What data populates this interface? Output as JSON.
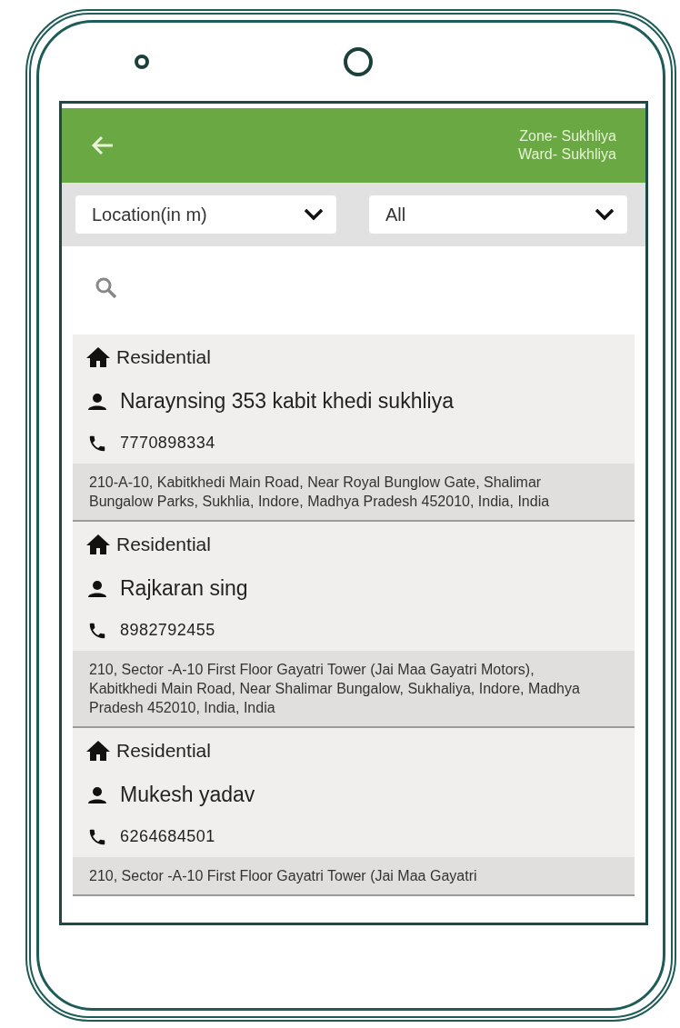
{
  "header": {
    "zone": "Zone- Sukhliya",
    "ward": "Ward- Sukhliya"
  },
  "filters": [
    {
      "value": "Location(in m)"
    },
    {
      "value": "All"
    }
  ],
  "records": [
    {
      "category": "Residential",
      "name": "Naraynsing 353 kabit khedi sukhliya",
      "phone": "7770898334",
      "address": "210-A-10, Kabitkhedi Main Road, Near Royal Bunglow Gate, Shalimar Bungalow Parks, Sukhlia, Indore, Madhya Pradesh 452010, India, India"
    },
    {
      "category": "Residential",
      "name": "Rajkaran sing",
      "phone": "8982792455",
      "address": "210, Sector -A-10 First Floor Gayatri Tower (Jai Maa Gayatri Motors), Kabitkhedi Main Road, Near Shalimar Bungalow, Sukhaliya, Indore, Madhya Pradesh 452010, India, India"
    },
    {
      "category": "Residential",
      "name": "Mukesh yadav",
      "phone": "6264684501",
      "address": "210, Sector -A-10 First Floor Gayatri Tower (Jai Maa Gayatri"
    }
  ]
}
